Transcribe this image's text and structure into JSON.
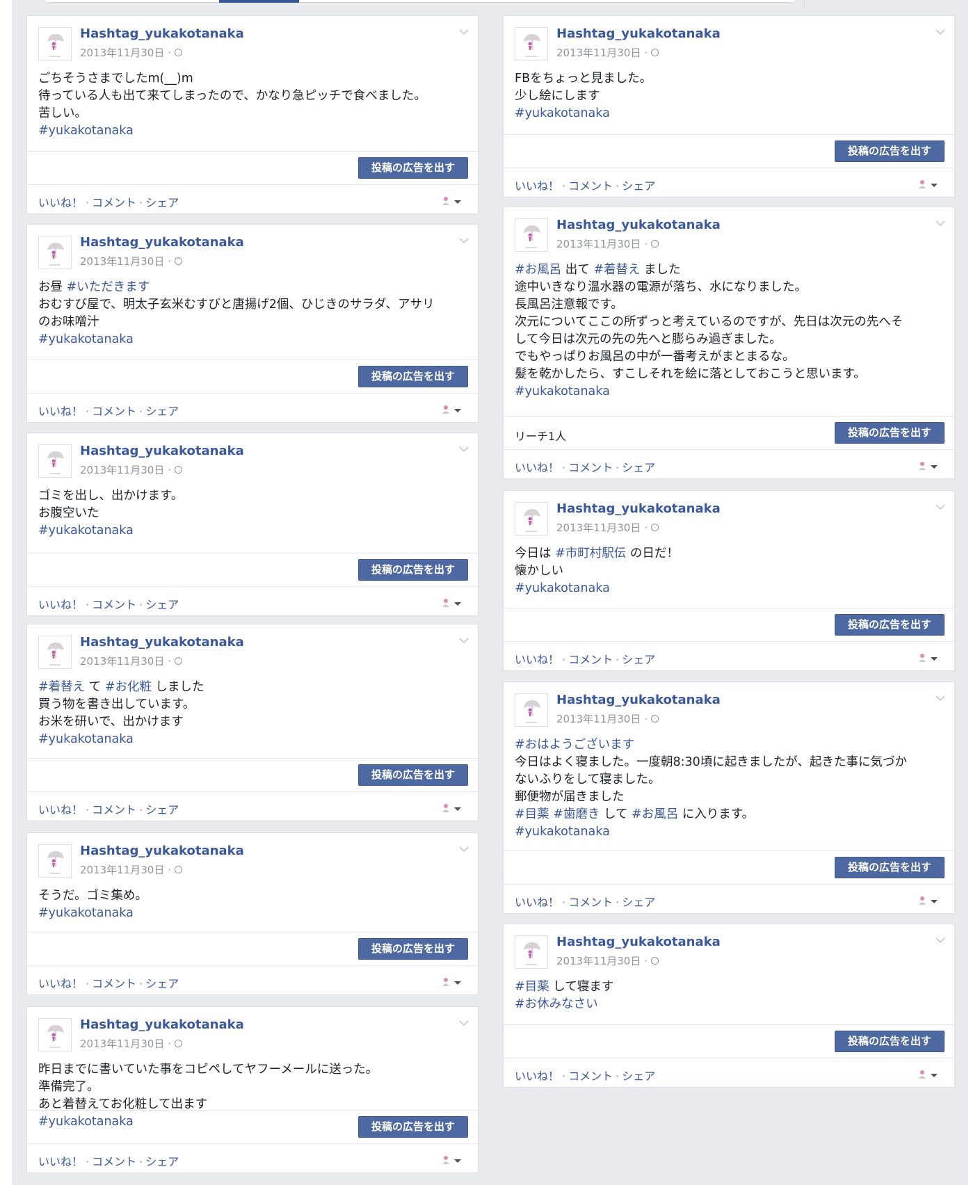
{
  "author": "Hashtag_yukakotanaka",
  "date": "2013年11月30日",
  "meta_sep": "·",
  "boost_label": "投稿の広告を出す",
  "actions": {
    "like": "いいね！",
    "comment": "コメント",
    "share": "シェア",
    "sep": "·"
  },
  "icons": {
    "avatar": "umbrella-girl-avatar",
    "audience": "globe-icon",
    "menu": "chevron-down-icon",
    "owner": "person-icon"
  },
  "colors": {
    "link": "#3b5998",
    "button": "#4e69a2",
    "background": "#e9eaed"
  },
  "left_posts": [
    {
      "lines": [
        [
          {
            "t": "ごちそうさまでしたm(__)m"
          }
        ],
        [
          {
            "t": "待っている人も出て来てしまったので、かなり急ピッチで食べました。"
          }
        ],
        [
          {
            "t": "苦しい。"
          }
        ],
        [
          {
            "t": "#yukakotanaka",
            "tag": true
          }
        ]
      ]
    },
    {
      "lines": [
        [
          {
            "t": "お昼 "
          },
          {
            "t": "#いただきます",
            "tag": true
          }
        ],
        [
          {
            "t": "おむすび屋で、明太子玄米むすびと唐揚げ2個、ひじきのサラダ、アサリ"
          }
        ],
        [
          {
            "t": "のお味噌汁"
          }
        ],
        [
          {
            "t": "#yukakotanaka",
            "tag": true
          }
        ]
      ]
    },
    {
      "lines": [
        [
          {
            "t": "ゴミを出し、出かけます。"
          }
        ],
        [
          {
            "t": "お腹空いた"
          }
        ],
        [
          {
            "t": "#yukakotanaka",
            "tag": true
          }
        ]
      ]
    },
    {
      "lines": [
        [
          {
            "t": "#着替え",
            "tag": true
          },
          {
            "t": " て "
          },
          {
            "t": "#お化粧",
            "tag": true
          },
          {
            "t": " しました"
          }
        ],
        [
          {
            "t": "買う物を書き出しています。"
          }
        ],
        [
          {
            "t": "お米を研いで、出かけます"
          }
        ],
        [
          {
            "t": "#yukakotanaka",
            "tag": true
          }
        ]
      ]
    },
    {
      "lines": [
        [
          {
            "t": "そうだ。ゴミ集め。"
          }
        ],
        [
          {
            "t": "#yukakotanaka",
            "tag": true
          }
        ]
      ]
    },
    {
      "lines": [
        [
          {
            "t": "昨日までに書いていた事をコピペしてヤフーメールに送った。"
          }
        ],
        [
          {
            "t": "準備完了。"
          }
        ],
        [
          {
            "t": "あと着替えてお化粧して出ます"
          }
        ],
        [
          {
            "t": "#yukakotanaka",
            "tag": true
          }
        ]
      ]
    }
  ],
  "right_posts": [
    {
      "lines": [
        [
          {
            "t": "FBをちょっと見ました。"
          }
        ],
        [
          {
            "t": "少し絵にします"
          }
        ],
        [
          {
            "t": "#yukakotanaka",
            "tag": true
          }
        ]
      ]
    },
    {
      "reach": "リーチ1人",
      "lines": [
        [
          {
            "t": "#お風呂",
            "tag": true
          },
          {
            "t": " 出て "
          },
          {
            "t": "#着替え",
            "tag": true
          },
          {
            "t": " ました"
          }
        ],
        [
          {
            "t": "途中いきなり温水器の電源が落ち、水になりました。"
          }
        ],
        [
          {
            "t": "長風呂注意報です。"
          }
        ],
        [
          {
            "t": "次元についてここの所ずっと考えているのですが、先日は次元の先へそ"
          }
        ],
        [
          {
            "t": "して今日は次元の先の先へと膨らみ過ぎました。"
          }
        ],
        [
          {
            "t": "でもやっぱりお風呂の中が一番考えがまとまるな。"
          }
        ],
        [
          {
            "t": "髪を乾かしたら、すこしそれを絵に落としておこうと思います。"
          }
        ],
        [
          {
            "t": "#yukakotanaka",
            "tag": true
          }
        ]
      ]
    },
    {
      "lines": [
        [
          {
            "t": "今日は "
          },
          {
            "t": "#市町村駅伝",
            "tag": true
          },
          {
            "t": " の日だ！"
          }
        ],
        [
          {
            "t": "懐かしい"
          }
        ],
        [
          {
            "t": "#yukakotanaka",
            "tag": true
          }
        ]
      ]
    },
    {
      "lines": [
        [
          {
            "t": "#おはようございます",
            "tag": true
          }
        ],
        [
          {
            "t": "今日はよく寝ました。一度朝8:30頃に起きましたが、起きた事に気づか"
          }
        ],
        [
          {
            "t": "ないふりをして寝ました。"
          }
        ],
        [
          {
            "t": "郵便物が届きました"
          }
        ],
        [
          {
            "t": "#目薬",
            "tag": true
          },
          {
            "t": " "
          },
          {
            "t": "#歯磨き",
            "tag": true
          },
          {
            "t": " して "
          },
          {
            "t": "#お風呂",
            "tag": true
          },
          {
            "t": " に入ります。"
          }
        ],
        [
          {
            "t": "#yukakotanaka",
            "tag": true
          }
        ]
      ]
    },
    {
      "lines": [
        [
          {
            "t": "#目薬",
            "tag": true
          },
          {
            "t": " して寝ます"
          }
        ],
        [
          {
            "t": "#お休みなさい",
            "tag": true
          }
        ]
      ]
    }
  ]
}
